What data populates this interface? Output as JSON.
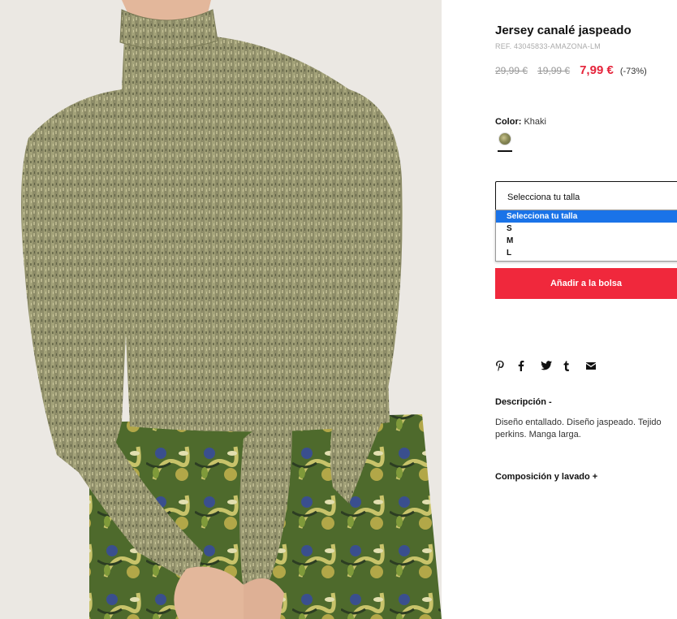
{
  "product": {
    "title": "Jersey canalé jaspeado",
    "ref": "REF. 43045833-AMAZONA-LM",
    "price_original": "29,99 €",
    "price_previous": "19,99 €",
    "price_current": "7,99 €",
    "discount": "(-73%)"
  },
  "color": {
    "label": "Color:",
    "value": "Khaki",
    "swatch_icon": "khaki-melange-swatch"
  },
  "size": {
    "select_value": "Selecciona tu talla",
    "options": [
      "Selecciona tu talla",
      "S",
      "M",
      "L"
    ],
    "highlight_color": "#1a73e8"
  },
  "add_to_bag": {
    "label": "Añadir a la bolsa",
    "color": "#f0283c"
  },
  "share": {
    "icons": [
      "pinterest-icon",
      "facebook-icon",
      "twitter-icon",
      "tumblr-icon",
      "email-icon"
    ]
  },
  "description": {
    "title": "Descripción -",
    "text": "Diseño entallado. Diseño jaspeado. Tejido perkins. Manga larga."
  },
  "composition": {
    "title": "Composición y lavado +"
  },
  "colors": {
    "price_sale": "#e5243b",
    "price_old": "#999999",
    "text": "#222222"
  }
}
